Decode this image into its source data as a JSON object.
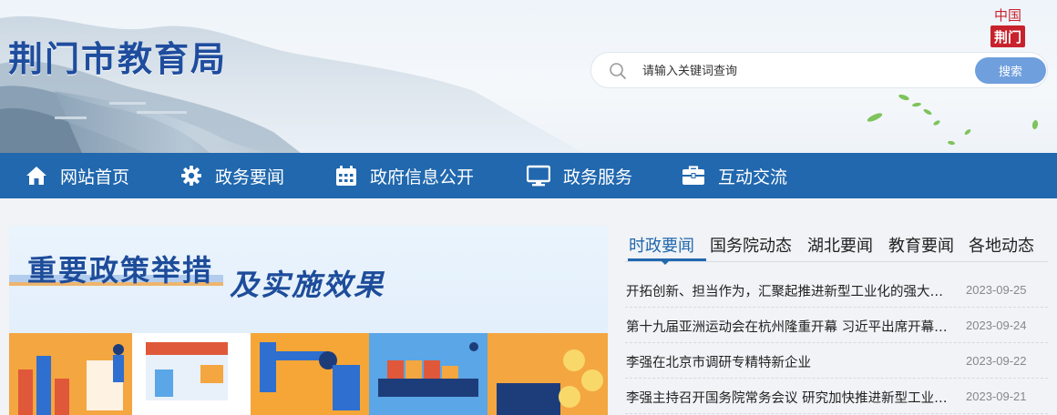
{
  "header": {
    "site_title": "荆门市教育局",
    "seal_text_top": "中国",
    "seal_text_bottom": "荆门"
  },
  "search": {
    "placeholder": "请输入关键词查询",
    "button_label": "搜索",
    "icon": "search-icon"
  },
  "nav": {
    "items": [
      {
        "label": "网站首页",
        "icon": "home-icon"
      },
      {
        "label": "政务要闻",
        "icon": "gear-icon"
      },
      {
        "label": "政府信息公开",
        "icon": "calendar-icon"
      },
      {
        "label": "政务服务",
        "icon": "monitor-icon"
      },
      {
        "label": "互动交流",
        "icon": "briefcase-icon"
      }
    ]
  },
  "banner": {
    "headline": "重要政策举措",
    "subheadline": "及实施效果"
  },
  "news": {
    "tabs": [
      "时政要闻",
      "国务院动态",
      "湖北要闻",
      "教育要闻",
      "各地动态"
    ],
    "active_tab": "时政要闻",
    "items": [
      {
        "title": "开拓创新、担当作为，汇聚起推进新型工业化的强大力量",
        "date": "2023-09-25"
      },
      {
        "title": "第十九届亚洲运动会在杭州隆重开幕 习近平出席开幕式并宣布本届亚运会开幕",
        "date": "2023-09-24"
      },
      {
        "title": "李强在北京市调研专精特新企业",
        "date": "2023-09-22"
      },
      {
        "title": "李强主持召开国务院常务会议 研究加快推进新型工业化等工作",
        "date": "2023-09-21"
      }
    ]
  },
  "colors": {
    "nav_bg": "#2168ae",
    "title_blue": "#1f4d9e",
    "search_button": "#6f9fdd",
    "seal_red": "#c8232c"
  }
}
